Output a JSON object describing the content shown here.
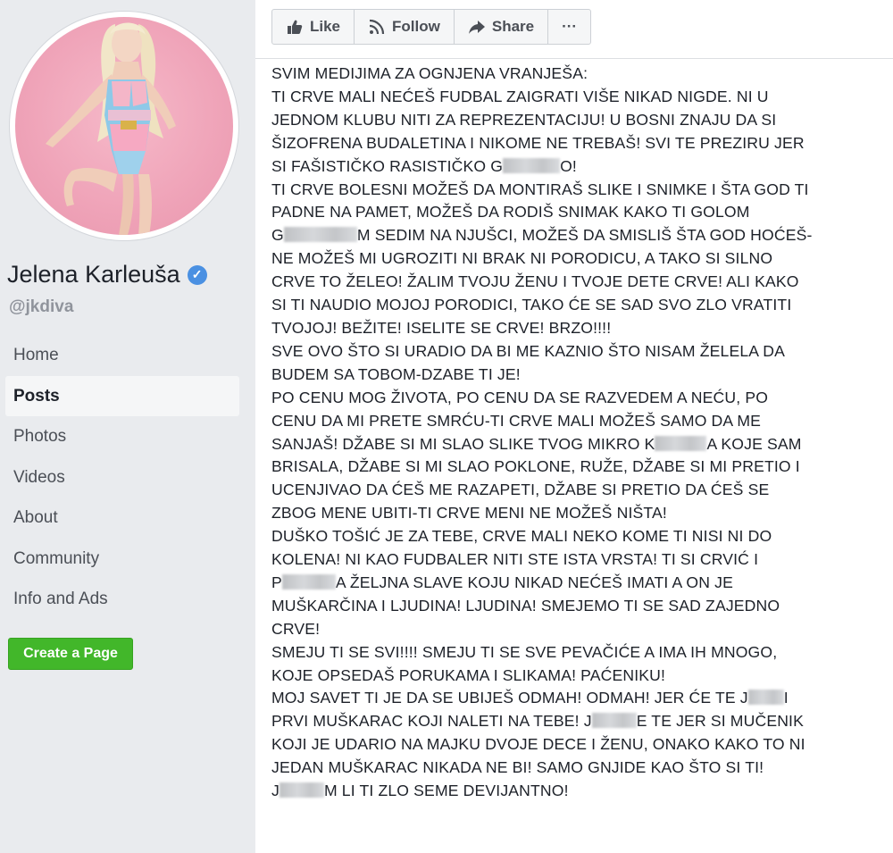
{
  "sidebar": {
    "page_name": "Jelena Karleuša",
    "username": "@jkdiva",
    "nav_items": [
      {
        "label": "Home"
      },
      {
        "label": "Posts",
        "active": true
      },
      {
        "label": "Photos"
      },
      {
        "label": "Videos"
      },
      {
        "label": "About"
      },
      {
        "label": "Community"
      },
      {
        "label": "Info and Ads"
      }
    ],
    "create_page_label": "Create a Page",
    "verified_icon": "verified-check-icon"
  },
  "actions": {
    "like_label": "Like",
    "follow_label": "Follow",
    "share_label": "Share",
    "more_label": "···"
  },
  "post": {
    "lines": [
      "SVIM MEDIJIMA ZA OGNJENA VRANJEŠA:",
      "TI CRVE MALI NEĆEŠ FUDBAL ZAIGRATI VIŠE NIKAD NIGDE. NI U",
      "JEDNOM KLUBU NITI ZA REPREZENTACIJU! U BOSNI ZNAJU DA SI",
      "ŠIZOFRENA BUDALETINA I NIKOME NE TREBAŠ! SVI TE PREZIRU JER",
      [
        "SI FAŠISTIČKO RASISTIČKO G",
        "",
        "O!"
      ],
      "TI CRVE BOLESNI MOŽEŠ DA MONTIRAŠ SLIKE I SNIMKE I ŠTA GOD TI",
      "PADNE NA PAMET, MOŽEŠ DA RODIŠ SNIMAK KAKO TI GOLOM",
      [
        "G",
        "",
        "M SEDIM NA NJUŠCI, MOŽEŠ DA SMISLIŠ ŠTA GOD HOĆEŠ-"
      ],
      "NE MOŽEŠ MI UGROZITI NI BRAK NI PORODICU, A TAKO SI SILNO",
      "CRVE TO ŽELEO! ŽALIM TVOJU ŽENU I TVOJE DETE CRVE! ALI KAKO",
      "SI TI NAUDIO MOJOJ PORODICI, TAKO ĆE SE SAD SVO ZLO VRATITI",
      "TVOJOJ! BEŽITE! ISELITE SE CRVE! BRZO!!!!",
      "SVE OVO ŠTO SI URADIO DA BI ME KAZNIO ŠTO NISAM ŽELELA DA",
      "BUDEM SA TOBOM-DZABE TI JE!",
      "PO CENU MOG ŽIVOTA, PO CENU DA SE RAZVEDEM A NEĆU, PO",
      "CENU DA MI PRETE SMRĆU-TI CRVE MALI MOŽEŠ SAMO DA ME",
      [
        "SANJAŠ! DŽABE SI MI SLAO SLIKE TVOG MIKRO K",
        "",
        "A KOJE SAM"
      ],
      "BRISALA, DŽABE SI MI SLAO POKLONE, RUŽE, DŽABE SI MI PRETIO I",
      "UCENJIVAO DA ĆEŠ ME RAZAPETI, DŽABE SI PRETIO DA ĆEŠ SE",
      "ZBOG MENE UBITI-TI CRVE MENI NE MOŽEŠ NIŠTA!",
      "DUŠKO TOŠIĆ JE ZA TEBE, CRVE MALI NEKO KOME TI NISI NI DO",
      "KOLENA! NI KAO FUDBALER NITI STE ISTA VRSTA! TI SI CRVIĆ I",
      [
        "P",
        "",
        "A ŽELJNA SLAVE KOJU NIKAD NEĆEŠ IMATI A ON JE"
      ],
      "MUŠKARČINA I LJUDINA! LJUDINA! SMEJEMO TI SE SAD ZAJEDNO",
      "CRVE!",
      "SMEJU TI SE SVI!!!! SMEJU TI SE SVE PEVAČIĆE A IMA IH MNOGO,",
      "KOJE OPSEDAŠ PORUKAMA I SLIKAMA! PAĆENIKU!",
      [
        "MOJ SAVET TI JE DA SE UBIJEŠ ODMAH! ODMAH! JER ĆE TE J",
        "",
        "I"
      ],
      [
        "PRVI MUŠKARAC KOJI NALETI NA TEBE! J",
        "",
        "E TE JER SI MUČENIK"
      ],
      "KOJI JE UDARIO NA MAJKU DVOJE DECE I ŽENU, ONAKO KAKO TO NI",
      "JEDAN MUŠKARAC NIKADA NE BI! SAMO GNJIDE KAO ŠTO SI TI!",
      [
        "J",
        "",
        "M LI TI ZLO SEME DEVIJANTNO!"
      ]
    ]
  },
  "colors": {
    "background": "#e9ebee",
    "text": "#1d2129",
    "accent_green": "#42b72a",
    "verified_blue": "#4a90e2",
    "muted": "#90949c"
  }
}
